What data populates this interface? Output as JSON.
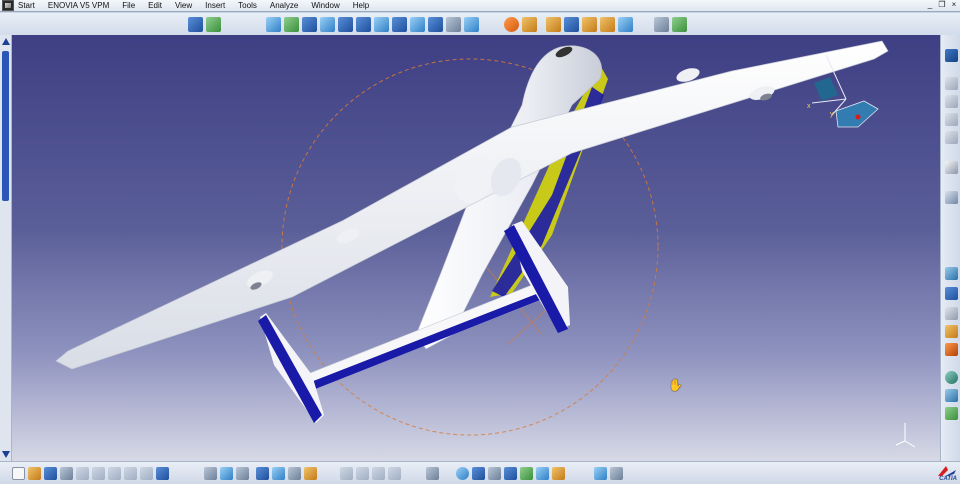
{
  "menubar": {
    "start": "Start",
    "items": [
      "ENOVIA V5 VPM",
      "File",
      "Edit",
      "View",
      "Insert",
      "Tools",
      "Analyze",
      "Window",
      "Help"
    ],
    "window_controls": [
      "_",
      "❐",
      "×"
    ]
  },
  "viewport": {
    "background_top": "#3e3f84",
    "background_bottom": "#d7d9e6",
    "compass_labels": {
      "x": "x",
      "y": "y"
    }
  },
  "colors": {
    "accent": "#2a56b8",
    "airframe": "#f4f4f4",
    "tail_stripe": "#1a1aa8",
    "yellow_stripe": "#c9c91a",
    "orbit_circle": "#d77b3a"
  },
  "right_toolbar": {
    "icons": [
      "view-icon",
      "part-icon",
      "part-icon",
      "part-icon",
      "part-icon",
      "select-arrow-icon",
      "settings-icon",
      "sketch-icon",
      "grid-icon",
      "body-icon",
      "hole-icon",
      "tools-icon",
      "rotate-icon",
      "axis-icon",
      "update-icon"
    ]
  },
  "bottom_toolbar": {
    "logo_text": "CATIA"
  }
}
